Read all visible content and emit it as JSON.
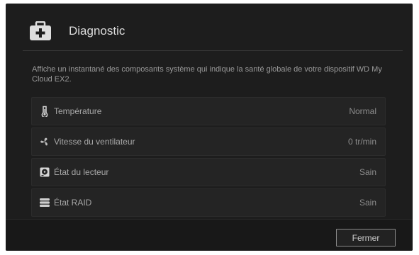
{
  "dialog": {
    "title": "Diagnostic",
    "title_icon": "first-aid-kit-icon",
    "description": "Affiche un instantané des composants système qui indique la santé globale de votre dispositif WD My Cloud EX2."
  },
  "rows": [
    {
      "icon": "thermometer-icon",
      "label": "Température",
      "value": "Normal"
    },
    {
      "icon": "fan-icon",
      "label": "Vitesse du ventilateur",
      "value": "0 tr/min"
    },
    {
      "icon": "hard-drive-icon",
      "label": "État du lecteur",
      "value": "Sain"
    },
    {
      "icon": "raid-stack-icon",
      "label": "État RAID",
      "value": "Sain"
    }
  ],
  "footer": {
    "close_label": "Fermer"
  },
  "colors": {
    "dialog_bg": "#1d1d1d",
    "row_bg": "#242424",
    "footer_bg": "#181818",
    "text_primary": "#dcdcdc",
    "text_secondary": "#9a9a9a"
  }
}
